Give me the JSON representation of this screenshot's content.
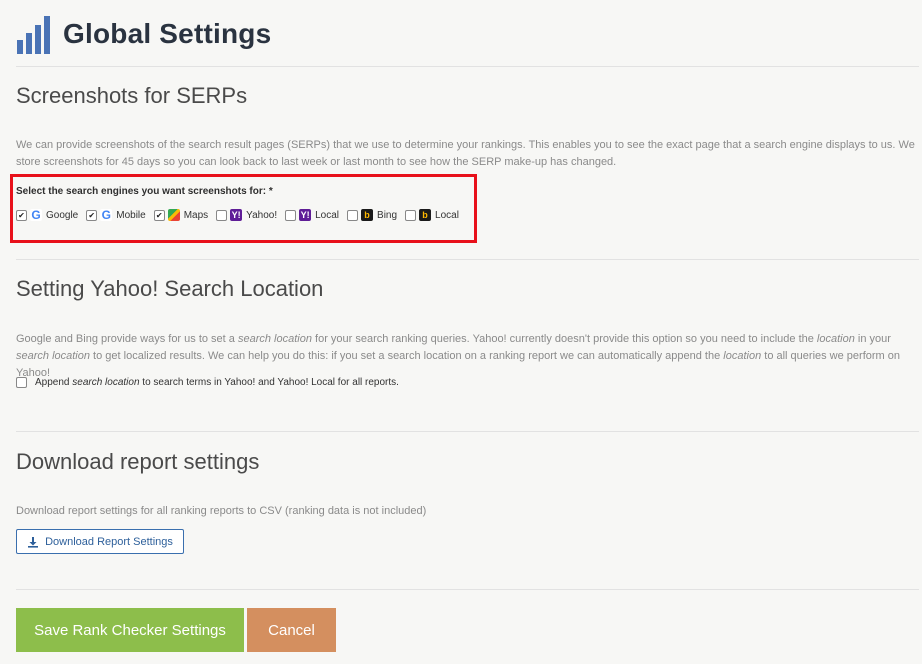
{
  "page": {
    "title": "Global Settings"
  },
  "screenshots": {
    "title": "Screenshots for SERPs",
    "description": "We can provide screenshots of the search result pages (SERPs) that we use to determine your rankings. This enables you to see the exact page that a search engine displays to us. We store screenshots for 45 days so you can look back to last week or last month to see how the SERP make-up has changed.",
    "engines_label": "Select the search engines you want screenshots for: *",
    "engines": [
      {
        "label": "Google",
        "checked": true,
        "icon": "google-icon"
      },
      {
        "label": "Mobile",
        "checked": true,
        "icon": "google-icon"
      },
      {
        "label": "Maps",
        "checked": true,
        "icon": "google-maps-icon"
      },
      {
        "label": "Yahoo!",
        "checked": false,
        "icon": "yahoo-icon"
      },
      {
        "label": "Local",
        "checked": false,
        "icon": "yahoo-icon"
      },
      {
        "label": "Bing",
        "checked": false,
        "icon": "bing-icon"
      },
      {
        "label": "Local",
        "checked": false,
        "icon": "bing-icon"
      }
    ]
  },
  "yahoo": {
    "title": "Setting Yahoo! Search Location",
    "desc_1": "Google and Bing provide ways for us to set a ",
    "desc_em1": "search location",
    "desc_2": " for your search ranking queries. Yahoo! currently doesn't provide this option so you need to include the ",
    "desc_em2": "location",
    "desc_3": " in your ",
    "desc_em3": "search location",
    "desc_4": " to get localized results. We can help you do this: if you set a search location on a ranking report we can automatically append the ",
    "desc_em4": "location",
    "desc_5": " to all queries we perform on Yahoo!",
    "append_1": "Append ",
    "append_em": "search location",
    "append_2": " to search terms in Yahoo! and Yahoo! Local for all reports."
  },
  "download": {
    "title": "Download report settings",
    "description": "Download report settings for all ranking reports to CSV (ranking data is not included)",
    "button_label": "Download Report Settings"
  },
  "actions": {
    "save_label": "Save Rank Checker Settings",
    "cancel_label": "Cancel"
  },
  "colors": {
    "highlight": "#e8101a",
    "save": "#8dbe4b",
    "cancel": "#d48f5f",
    "logo": "#4a73b5"
  }
}
